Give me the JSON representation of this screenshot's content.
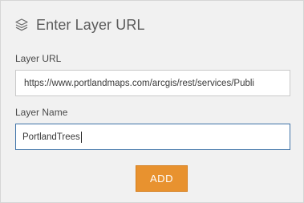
{
  "dialog": {
    "title": "Enter Layer URL",
    "icon": "layers-icon"
  },
  "form": {
    "layer_url_label": "Layer URL",
    "layer_url_value": "https://www.portlandmaps.com/arcgis/rest/services/Publi",
    "layer_name_label": "Layer Name",
    "layer_name_value": "PortlandTrees"
  },
  "actions": {
    "add_label": "ADD"
  },
  "colors": {
    "accent": "#e8922f",
    "focus_border": "#3f73a8",
    "panel_bg": "#f1f1f1"
  }
}
